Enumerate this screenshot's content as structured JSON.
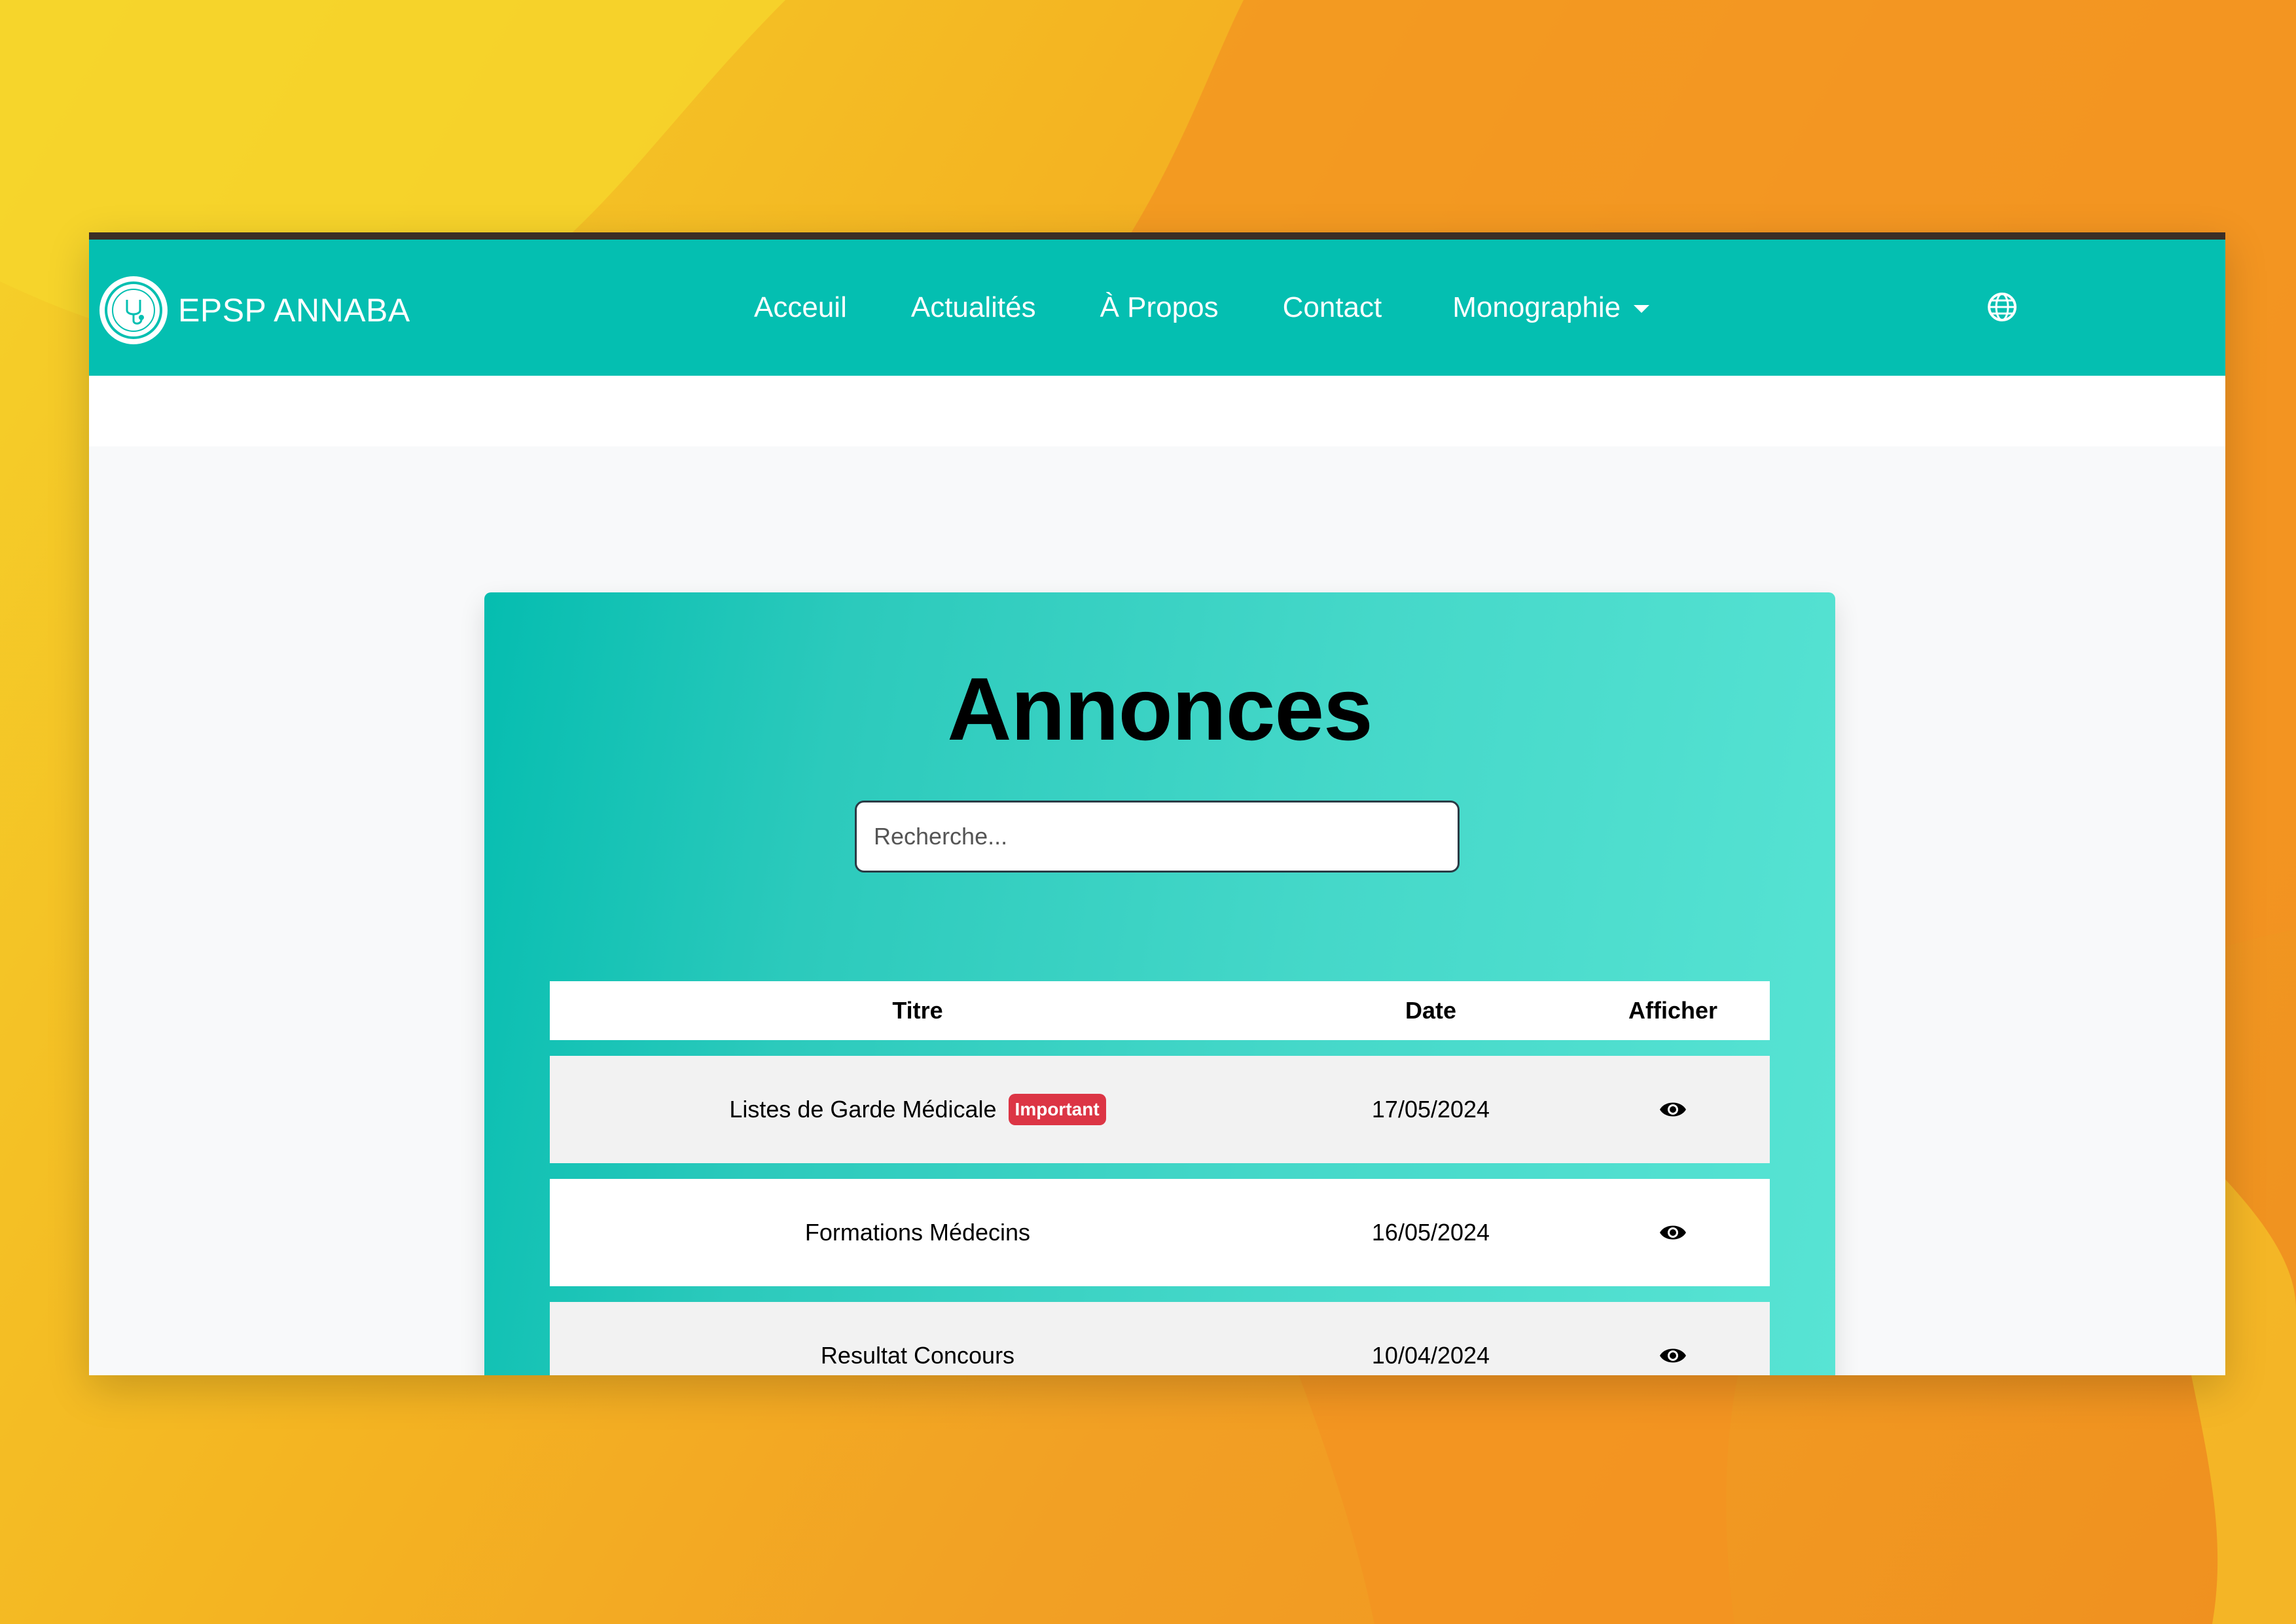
{
  "brand": {
    "name": "EPSP ANNABA",
    "logo_icon": "stethoscope-emblem-icon"
  },
  "nav": {
    "items": [
      "Acceuil",
      "Actualités",
      "À Propos",
      "Contact"
    ],
    "dropdown_label": "Monographie",
    "language_icon": "globe-icon"
  },
  "page": {
    "title": "Annonces",
    "search_placeholder": "Recherche..."
  },
  "table": {
    "headers": {
      "title": "Titre",
      "date": "Date",
      "view": "Afficher"
    },
    "rows": [
      {
        "title": "Listes de Garde Médicale",
        "badge": "Important",
        "date": "17/05/2024",
        "view_icon": "eye-icon"
      },
      {
        "title": "Formations Médecins",
        "badge": "",
        "date": "16/05/2024",
        "view_icon": "eye-icon"
      },
      {
        "title": "Resultat Concours",
        "badge": "",
        "date": "10/04/2024",
        "view_icon": "eye-icon"
      }
    ]
  },
  "colors": {
    "navbar": "#04bfb1",
    "badge": "#dc3545",
    "background_warm": "#f2a024"
  }
}
